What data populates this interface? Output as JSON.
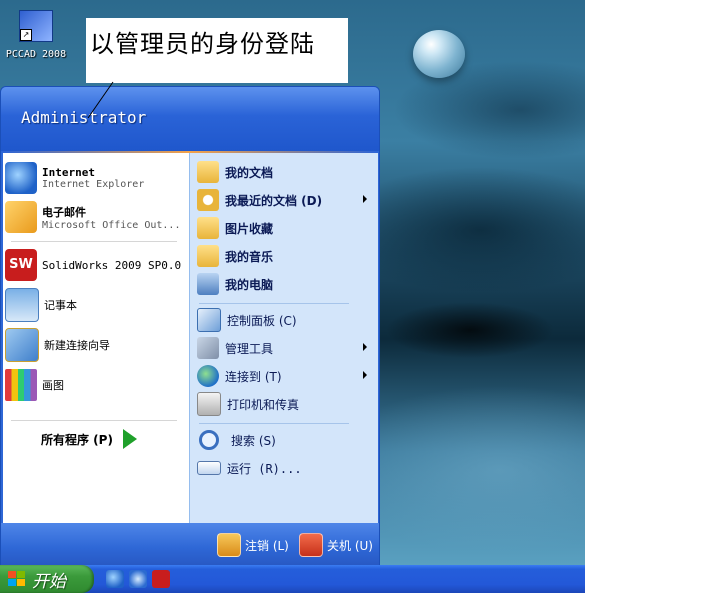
{
  "desktop": {
    "icon_label": "PCCAD 2008"
  },
  "annotation": {
    "text": "以管理员的身份登陆"
  },
  "start_menu": {
    "user_name": "Administrator",
    "pinned": [
      {
        "title": "Internet",
        "subtitle": "Internet Explorer",
        "icon": "internet-explorer-icon"
      },
      {
        "title": "电子邮件",
        "subtitle": "Microsoft Office Out...",
        "icon": "outlook-icon"
      }
    ],
    "recent": [
      {
        "title": "SolidWorks 2009 SP0.0",
        "icon": "solidworks-icon"
      },
      {
        "title": "记事本",
        "icon": "notepad-icon"
      },
      {
        "title": "新建连接向导",
        "icon": "connection-wizard-icon"
      },
      {
        "title": "画图",
        "icon": "paint-icon"
      }
    ],
    "all_programs": "所有程序 (P)",
    "places": [
      {
        "label": "我的文档",
        "icon": "folder-icon"
      },
      {
        "label": "我最近的文档 (D)",
        "icon": "recent-documents-icon"
      },
      {
        "label": "图片收藏",
        "icon": "pictures-folder-icon"
      },
      {
        "label": "我的音乐",
        "icon": "music-folder-icon"
      },
      {
        "label": "我的电脑",
        "icon": "computer-icon"
      }
    ],
    "system": [
      {
        "label": "控制面板 (C)",
        "icon": "control-panel-icon"
      },
      {
        "label": "管理工具",
        "icon": "admin-tools-icon"
      },
      {
        "label": "连接到 (T)",
        "icon": "network-globe-icon"
      },
      {
        "label": "打印机和传真",
        "icon": "printer-icon"
      }
    ],
    "tools": [
      {
        "label": "搜索 (S)",
        "icon": "search-icon"
      },
      {
        "label": "运行 (R)...",
        "icon": "run-icon"
      }
    ],
    "footer": {
      "logoff": "注销 (L)",
      "shutdown": "关机 (U)"
    }
  },
  "taskbar": {
    "start_label": "开始",
    "quick_launch": [
      "internet-explorer-icon",
      "outlook-express-icon",
      "solidworks-icon"
    ]
  },
  "colors": {
    "start_menu_blue": "#2e67d6",
    "right_pane": "#d3e5fa",
    "start_button_green": "#3b9a3b",
    "taskbar_blue": "#245edb"
  }
}
